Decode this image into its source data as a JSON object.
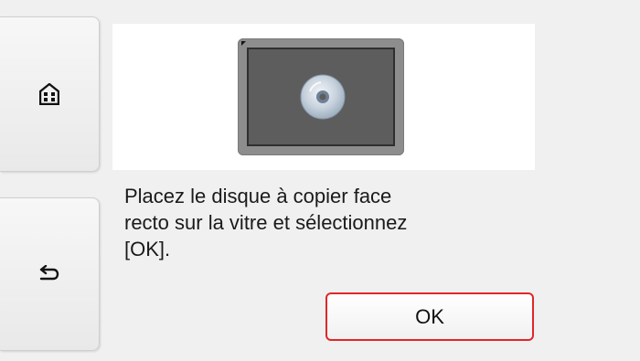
{
  "navigation": {
    "home_icon": "home-icon",
    "back_icon": "back-arrow-icon"
  },
  "illustration": {
    "icon": "disc-on-scanner-glass"
  },
  "message": {
    "text": "Placez le disque à copier face\nrecto sur la vitre et sélectionnez\n[OK]."
  },
  "actions": {
    "ok_label": "OK"
  },
  "colors": {
    "ok_border": "#e0262a",
    "background": "#f0f0f0",
    "panel": "#ffffff"
  }
}
